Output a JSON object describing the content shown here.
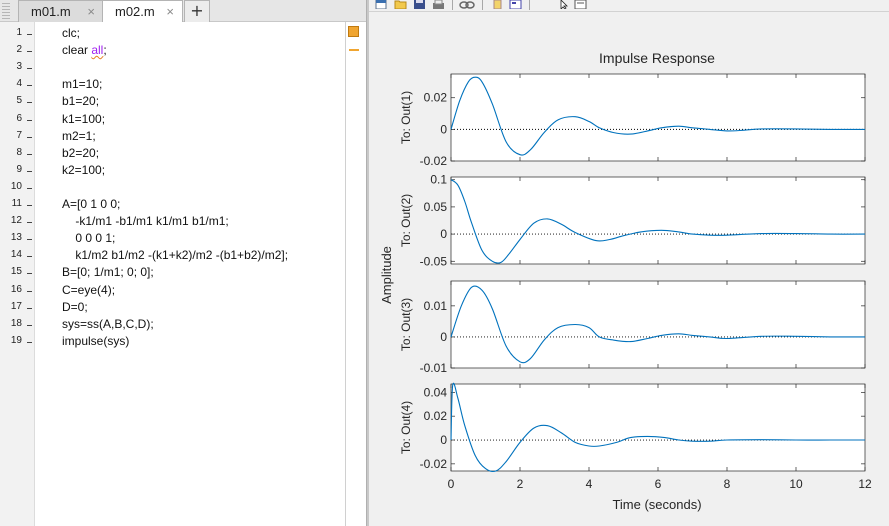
{
  "editor": {
    "tabs": [
      {
        "label": "m01.m",
        "close": "×",
        "active": false
      },
      {
        "label": "m02.m",
        "close": "×",
        "active": true
      }
    ],
    "add_tab": "+",
    "lines": [
      {
        "n": "1",
        "text": "clc;"
      },
      {
        "n": "2",
        "pre": "clear ",
        "kw": "all",
        "post": ";"
      },
      {
        "n": "3",
        "text": ""
      },
      {
        "n": "4",
        "text": "m1=10;"
      },
      {
        "n": "5",
        "text": "b1=20;"
      },
      {
        "n": "6",
        "text": "k1=100;"
      },
      {
        "n": "7",
        "text": "m2=1;"
      },
      {
        "n": "8",
        "text": "b2=20;"
      },
      {
        "n": "9",
        "text": "k2=100;"
      },
      {
        "n": "10",
        "text": ""
      },
      {
        "n": "11",
        "text": "A=[0 1 0 0;"
      },
      {
        "n": "12",
        "text": "    -k1/m1 -b1/m1 k1/m1 b1/m1;"
      },
      {
        "n": "13",
        "text": "    0 0 0 1;"
      },
      {
        "n": "14",
        "text": "    k1/m2 b1/m2 -(k1+k2)/m2 -(b1+b2)/m2];"
      },
      {
        "n": "15",
        "text": "B=[0; 1/m1; 0; 0];"
      },
      {
        "n": "16",
        "text": "C=eye(4);"
      },
      {
        "n": "17",
        "text": "D=0;"
      },
      {
        "n": "18",
        "text": "sys=ss(A,B,C,D);"
      },
      {
        "n": "19",
        "text": "impulse(sys)"
      }
    ],
    "colors": {
      "warning": "#f0a530",
      "keyword": "#a020f0"
    }
  },
  "figure": {
    "toolbar_icons": [
      "new-figure-icon",
      "open-file-icon",
      "save-icon",
      "print-icon",
      "link-icon",
      "insert-colorbar-icon",
      "insert-legend-icon",
      "pointer-icon",
      "edit-plot-icon"
    ],
    "line_color": "#0072bd"
  },
  "chart_data": {
    "type": "line",
    "title": "Impulse Response",
    "xlabel": "Time (seconds)",
    "ylabel": "Amplitude",
    "xlim": [
      0,
      12
    ],
    "xticks": [
      "0",
      "2",
      "4",
      "6",
      "8",
      "10",
      "12"
    ],
    "grid": false,
    "subplots": [
      {
        "label": "To: Out(1)",
        "ylim": [
          -0.02,
          0.035
        ],
        "ytick_values": [
          0.02,
          0,
          -0.02
        ],
        "yticks": [
          "0.02",
          "0",
          "-0.02"
        ],
        "x": [
          0,
          0.25,
          0.5,
          0.7,
          0.9,
          1.2,
          1.6,
          2.0,
          2.3,
          2.7,
          3.1,
          3.6,
          4.0,
          4.3,
          4.7,
          5.2,
          5.7,
          6.1,
          6.6,
          7.0,
          7.5,
          8.0,
          8.5,
          9.0,
          10,
          11,
          12
        ],
        "y": [
          0,
          0.018,
          0.03,
          0.033,
          0.03,
          0.016,
          -0.008,
          -0.016,
          -0.013,
          -0.002,
          0.006,
          0.008,
          0.005,
          0.001,
          -0.002,
          -0.003,
          -0.001,
          0.001,
          0.002,
          0.001,
          0.0,
          -0.001,
          -0.0005,
          0.0003,
          0.0003,
          0.0,
          0.0
        ]
      },
      {
        "label": "To: Out(2)",
        "ylim": [
          -0.055,
          0.105
        ],
        "ytick_values": [
          0.1,
          0.05,
          0,
          -0.05
        ],
        "yticks": [
          "0.1",
          "0.05",
          "0",
          "-0.05"
        ],
        "x": [
          0,
          0.2,
          0.4,
          0.6,
          0.9,
          1.2,
          1.45,
          1.7,
          2.0,
          2.4,
          2.8,
          3.2,
          3.6,
          4.2,
          4.6,
          5.0,
          5.5,
          6.1,
          6.6,
          7.0,
          7.5,
          8.0,
          9.0,
          10,
          11,
          12
        ],
        "y": [
          0.1,
          0.09,
          0.06,
          0.02,
          -0.03,
          -0.05,
          -0.052,
          -0.035,
          -0.01,
          0.02,
          0.028,
          0.018,
          0.003,
          -0.012,
          -0.01,
          -0.003,
          0.004,
          0.007,
          0.004,
          0.0,
          -0.002,
          -0.002,
          0.001,
          0.001,
          0.0,
          0.0
        ]
      },
      {
        "label": "To: Out(3)",
        "ylim": [
          -0.01,
          0.018
        ],
        "ytick_values": [
          0.01,
          0,
          -0.01
        ],
        "yticks": [
          "0.01",
          "0",
          "-0.01"
        ],
        "x": [
          0,
          0.3,
          0.6,
          0.9,
          1.2,
          1.6,
          2.0,
          2.3,
          2.7,
          3.1,
          3.6,
          4.0,
          4.3,
          4.7,
          5.2,
          5.7,
          6.1,
          6.6,
          7.0,
          7.5,
          8.0,
          9.0,
          10,
          11,
          12
        ],
        "y": [
          0,
          0.01,
          0.016,
          0.015,
          0.009,
          -0.003,
          -0.008,
          -0.007,
          -0.001,
          0.003,
          0.004,
          0.003,
          0.0,
          -0.001,
          -0.0015,
          -0.0005,
          0.0005,
          0.001,
          0.0005,
          0.0,
          -0.0005,
          0.0002,
          0.0002,
          0.0,
          0.0
        ]
      },
      {
        "label": "To: Out(4)",
        "ylim": [
          -0.026,
          0.047
        ],
        "ytick_values": [
          0.04,
          0.02,
          0,
          -0.02
        ],
        "yticks": [
          "0.04",
          "0.02",
          "0",
          "-0.02"
        ],
        "x": [
          0,
          0.05,
          0.2,
          0.4,
          0.7,
          1.0,
          1.3,
          1.6,
          2.0,
          2.4,
          2.8,
          3.2,
          3.6,
          4.0,
          4.3,
          4.8,
          5.2,
          5.7,
          6.2,
          6.6,
          7.0,
          7.5,
          8.0,
          9.0,
          10,
          11,
          12
        ],
        "y": [
          0,
          0.046,
          0.035,
          0.012,
          -0.013,
          -0.024,
          -0.026,
          -0.018,
          -0.002,
          0.01,
          0.012,
          0.006,
          -0.002,
          -0.005,
          -0.005,
          -0.002,
          0.002,
          0.003,
          0.002,
          0.0,
          -0.001,
          -0.001,
          0.0,
          0.0003,
          0.0,
          0.0,
          0.0
        ]
      }
    ]
  }
}
